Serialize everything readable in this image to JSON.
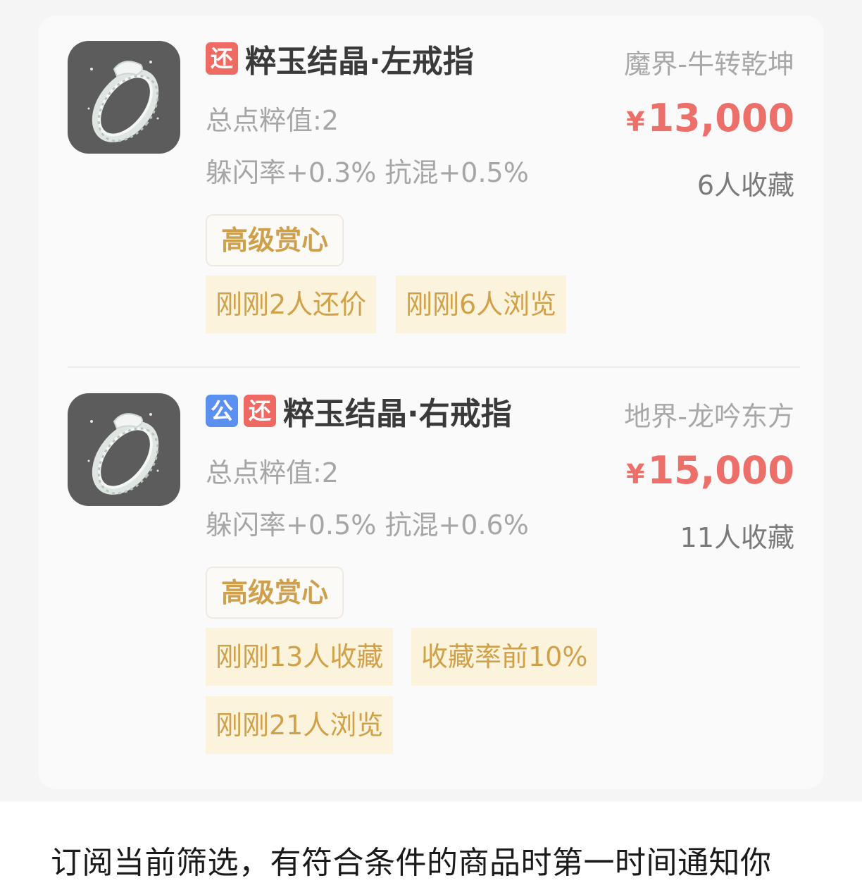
{
  "listings": [
    {
      "badges": [
        "还"
      ],
      "title": "粹玉结晶·左戒指",
      "server": "魔界-牛转乾坤",
      "points": "总点粹值:2",
      "stats": "躲闪率+0.3% 抗混+0.5%",
      "currency": "¥",
      "price": "13,000",
      "favorites": "6人收藏",
      "grade_tag": "高级赏心",
      "activity_tags": [
        "刚刚2人还价",
        "刚刚6人浏览"
      ]
    },
    {
      "badges": [
        "公",
        "还"
      ],
      "title": "粹玉结晶·右戒指",
      "server": "地界-龙吟东方",
      "points": "总点粹值:2",
      "stats": "躲闪率+0.5% 抗混+0.6%",
      "currency": "¥",
      "price": "15,000",
      "favorites": "11人收藏",
      "grade_tag": "高级赏心",
      "activity_tags": [
        "刚刚13人收藏",
        "收藏率前10%",
        "刚刚21人浏览"
      ]
    }
  ],
  "footer": {
    "notice": "订阅当前筛选，有符合条件的商品时第一时间通知你"
  },
  "colors": {
    "price": "#ec6f69",
    "badge_public": "#5b8ff0",
    "badge_counter": "#ef6a62",
    "tag_text": "#d1a14a",
    "tag_bg": "#fbf3dc"
  },
  "icons": {
    "item_thumbnail": "ring-icon"
  }
}
